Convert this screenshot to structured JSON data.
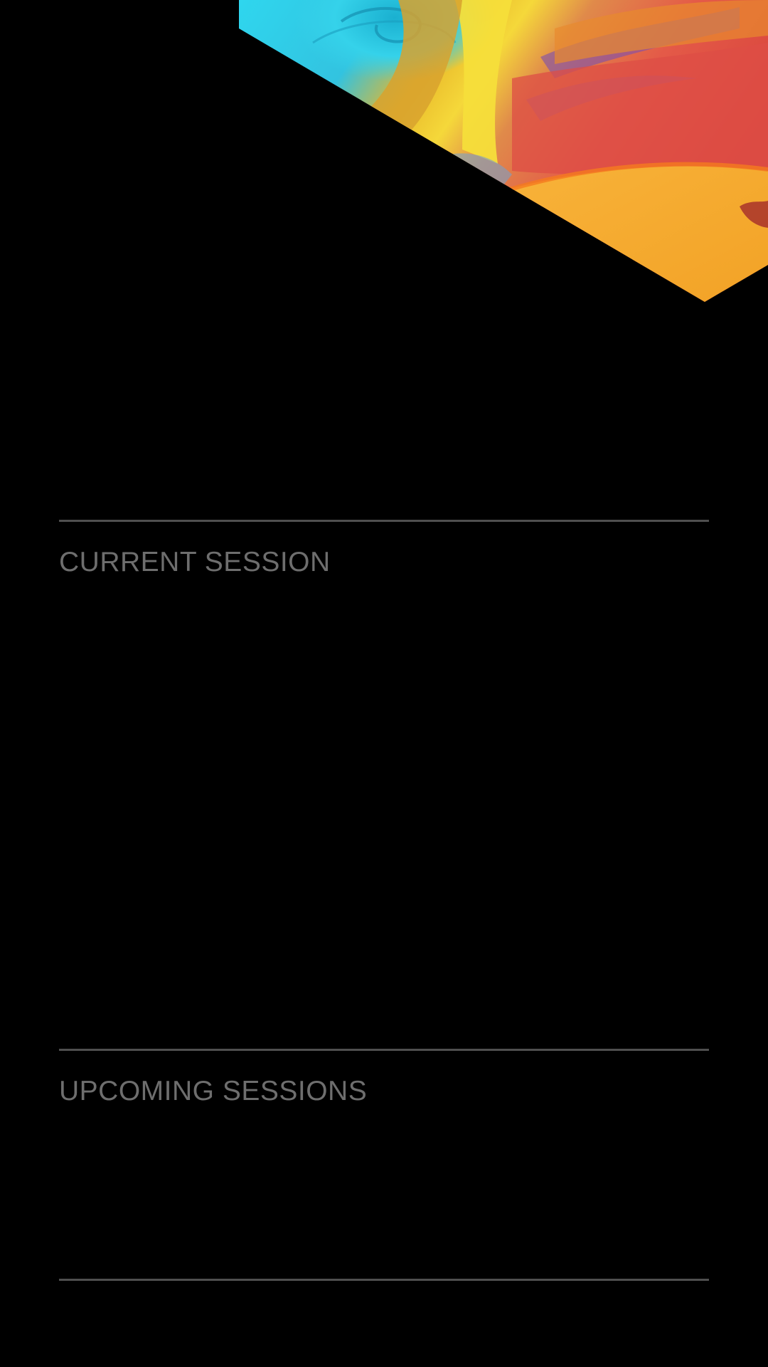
{
  "sections": {
    "current_title": "CURRENT SESSION",
    "upcoming_title": "UPCOMING SESSIONS"
  },
  "colors": {
    "background": "#000000",
    "divider": "#4f4f4f",
    "section_title": "#6e6e6e"
  },
  "hero": {
    "icon": "abstract-paint-artwork"
  }
}
